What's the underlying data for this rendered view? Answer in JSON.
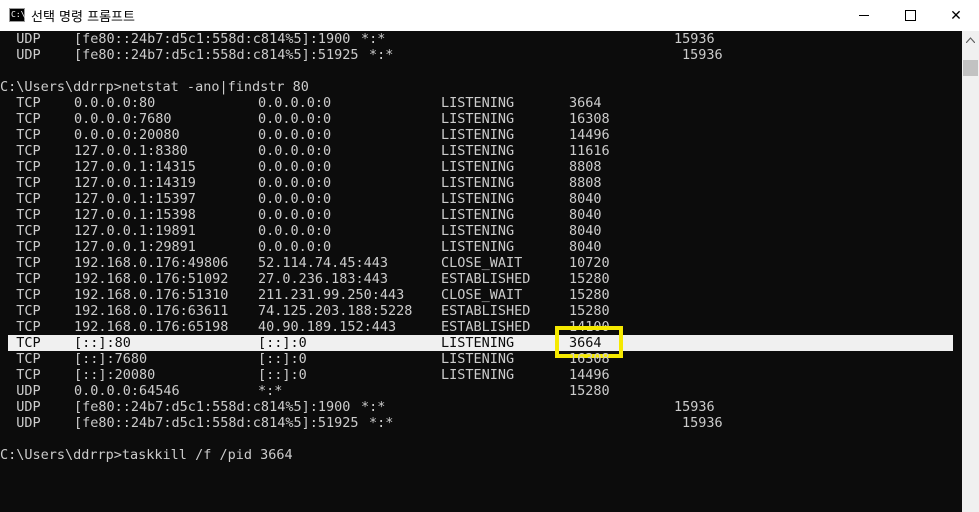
{
  "window": {
    "title": "선택 명령 프롬프트",
    "icon_label": "C:\\",
    "minimize_icon": "minimize-icon",
    "maximize_icon": "maximize-icon",
    "close_icon": "close-icon",
    "close_glyph": "✕"
  },
  "console": {
    "lines": [
      {
        "c1": "  UDP",
        "c2": "[fe80::24b7:d5c1:558d:c814%5]:1900",
        "c3": "*:*",
        "c4": "",
        "c5": "15936"
      },
      {
        "c1": "  UDP",
        "c2": "[fe80::24b7:d5c1:558d:c814%5]:51925",
        "c3": "*:*",
        "c4": "",
        "c5": "15936"
      },
      {
        "c1": "",
        "c2": "",
        "c3": "",
        "c4": "",
        "c5": ""
      },
      {
        "prompt": "C:\\Users\\ddrrp>netstat -ano|findstr 80"
      },
      {
        "c1": "  TCP",
        "c2": "0.0.0.0:80",
        "c3": "0.0.0.0:0",
        "c4": "LISTENING",
        "c5": "3664"
      },
      {
        "c1": "  TCP",
        "c2": "0.0.0.0:7680",
        "c3": "0.0.0.0:0",
        "c4": "LISTENING",
        "c5": "16308"
      },
      {
        "c1": "  TCP",
        "c2": "0.0.0.0:20080",
        "c3": "0.0.0.0:0",
        "c4": "LISTENING",
        "c5": "14496"
      },
      {
        "c1": "  TCP",
        "c2": "127.0.0.1:8380",
        "c3": "0.0.0.0:0",
        "c4": "LISTENING",
        "c5": "11616"
      },
      {
        "c1": "  TCP",
        "c2": "127.0.0.1:14315",
        "c3": "0.0.0.0:0",
        "c4": "LISTENING",
        "c5": "8808"
      },
      {
        "c1": "  TCP",
        "c2": "127.0.0.1:14319",
        "c3": "0.0.0.0:0",
        "c4": "LISTENING",
        "c5": "8808"
      },
      {
        "c1": "  TCP",
        "c2": "127.0.0.1:15397",
        "c3": "0.0.0.0:0",
        "c4": "LISTENING",
        "c5": "8040"
      },
      {
        "c1": "  TCP",
        "c2": "127.0.0.1:15398",
        "c3": "0.0.0.0:0",
        "c4": "LISTENING",
        "c5": "8040"
      },
      {
        "c1": "  TCP",
        "c2": "127.0.0.1:19891",
        "c3": "0.0.0.0:0",
        "c4": "LISTENING",
        "c5": "8040"
      },
      {
        "c1": "  TCP",
        "c2": "127.0.0.1:29891",
        "c3": "0.0.0.0:0",
        "c4": "LISTENING",
        "c5": "8040"
      },
      {
        "c1": "  TCP",
        "c2": "192.168.0.176:49806",
        "c3": "52.114.74.45:443",
        "c4": "CLOSE_WAIT",
        "c5": "10720"
      },
      {
        "c1": "  TCP",
        "c2": "192.168.0.176:51092",
        "c3": "27.0.236.183:443",
        "c4": "ESTABLISHED",
        "c5": "15280"
      },
      {
        "c1": "  TCP",
        "c2": "192.168.0.176:51310",
        "c3": "211.231.99.250:443",
        "c4": "CLOSE_WAIT",
        "c5": "15280"
      },
      {
        "c1": "  TCP",
        "c2": "192.168.0.176:63611",
        "c3": "74.125.203.188:5228",
        "c4": "ESTABLISHED",
        "c5": "15280"
      },
      {
        "c1": "  TCP",
        "c2": "192.168.0.176:65198",
        "c3": "40.90.189.152:443",
        "c4": "ESTABLISHED",
        "c5": "14100"
      },
      {
        "c1": "  TCP",
        "c2": "[::]:80",
        "c3": "[::]:0",
        "c4": "LISTENING",
        "c5": "3664",
        "selected": true
      },
      {
        "c1": "  TCP",
        "c2": "[::]:7680",
        "c3": "[::]:0",
        "c4": "LISTENING",
        "c5": "16308"
      },
      {
        "c1": "  TCP",
        "c2": "[::]:20080",
        "c3": "[::]:0",
        "c4": "LISTENING",
        "c5": "14496"
      },
      {
        "c1": "  UDP",
        "c2": "0.0.0.0:64546",
        "c3": "*:*",
        "c4": "",
        "c5": "15280"
      },
      {
        "c1": "  UDP",
        "c2": "[fe80::24b7:d5c1:558d:c814%5]:1900",
        "c3": "*:*",
        "c4": "",
        "c5": "15936"
      },
      {
        "c1": "  UDP",
        "c2": "[fe80::24b7:d5c1:558d:c814%5]:51925",
        "c3": "*:*",
        "c4": "",
        "c5": "15936"
      },
      {
        "c1": "",
        "c2": "",
        "c3": "",
        "c4": "",
        "c5": ""
      },
      {
        "prompt": "C:\\Users\\ddrrp>taskkill /f /pid 3664"
      }
    ]
  },
  "colors": {
    "console_bg": "#0c0c0c",
    "console_text": "#cccccc",
    "selection_bg": "#f0f0f0",
    "highlight_border": "#f5e900"
  }
}
